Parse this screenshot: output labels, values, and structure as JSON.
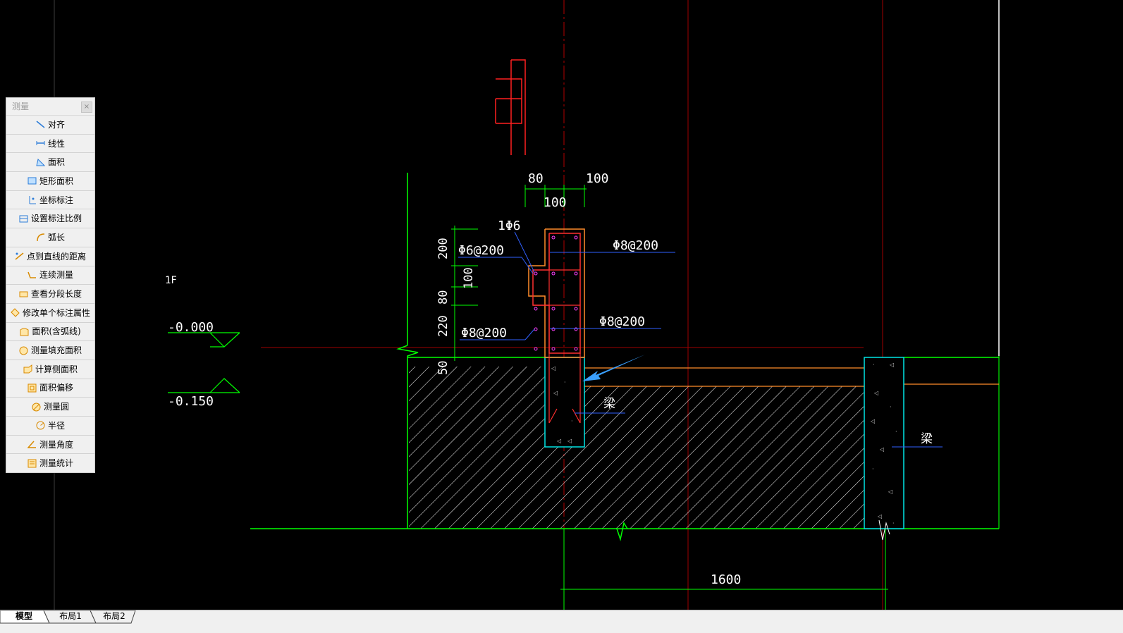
{
  "panel": {
    "title": "测量",
    "close_label": "×",
    "items": [
      {
        "label": "对齐",
        "icon": "align-measure-icon"
      },
      {
        "label": "线性",
        "icon": "linear-measure-icon"
      },
      {
        "label": "面积",
        "icon": "area-icon"
      },
      {
        "label": "矩形面积",
        "icon": "rect-area-icon"
      },
      {
        "label": "坐标标注",
        "icon": "coordinate-icon"
      },
      {
        "label": "设置标注比例",
        "icon": "scale-icon"
      },
      {
        "label": "弧长",
        "icon": "arc-length-icon"
      },
      {
        "label": "点到直线的距离",
        "icon": "point-line-distance-icon"
      },
      {
        "label": "连续测量",
        "icon": "continuous-measure-icon"
      },
      {
        "label": "查看分段长度",
        "icon": "segment-length-icon"
      },
      {
        "label": "修改单个标注属性",
        "icon": "edit-dim-icon"
      },
      {
        "label": "面积(含弧线)",
        "icon": "arc-area-icon"
      },
      {
        "label": "测量填充面积",
        "icon": "hatch-area-icon"
      },
      {
        "label": "计算侧面积",
        "icon": "side-area-icon"
      },
      {
        "label": "面积偏移",
        "icon": "area-offset-icon"
      },
      {
        "label": "测量圆",
        "icon": "circle-icon"
      },
      {
        "label": "半径",
        "icon": "radius-icon"
      },
      {
        "label": "测量角度",
        "icon": "angle-icon"
      },
      {
        "label": "测量统计",
        "icon": "statistics-icon"
      }
    ]
  },
  "drawing": {
    "floor_label": "1F",
    "level_1": "-0.000",
    "level_2": "-0.150",
    "dim_80_top": "80",
    "dim_100_top": "100",
    "dim_100_mid": "100",
    "rebar_1": "1Φ6",
    "rebar_2": "Φ6@200",
    "rebar_3": "Φ8@200",
    "rebar_4": "Φ8@200",
    "rebar_5": "Φ8@200",
    "dim_200": "200",
    "dim_100_v": "100",
    "dim_80_v": "80",
    "dim_220": "220",
    "dim_50": "50",
    "beam_label_1": "梁",
    "beam_label_2": "梁",
    "dim_1600": "1600"
  },
  "tabs": [
    "模型",
    "布局1",
    "布局2"
  ],
  "colors": {
    "background": "#000000",
    "green": "#00ff00",
    "cyan": "#00ffff",
    "red": "#ff0000",
    "darkred": "#a00000",
    "orange": "#ff7f27",
    "blue": "#2f6bff",
    "arrow": "#3aa0ff"
  }
}
